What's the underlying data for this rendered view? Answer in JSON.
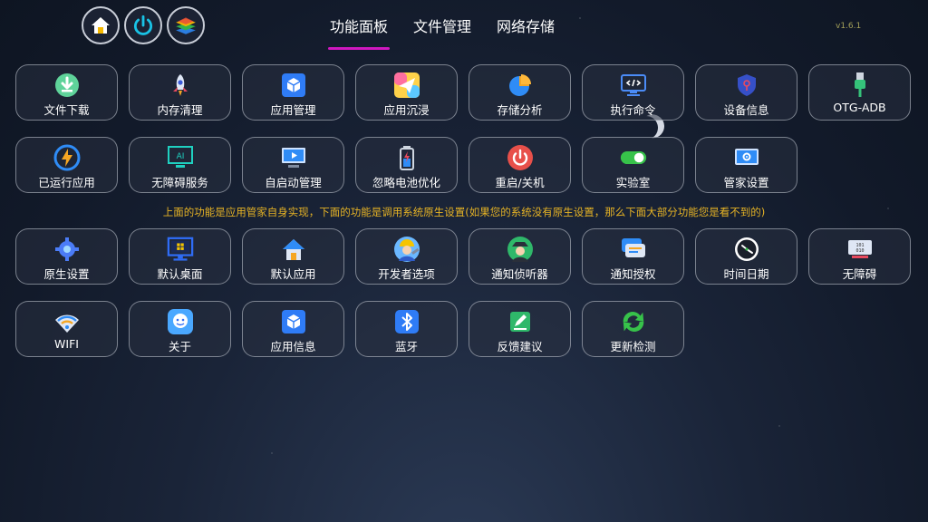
{
  "header": {
    "tabs": [
      "功能面板",
      "文件管理",
      "网络存储"
    ],
    "version": "v1.6.1"
  },
  "top_icons": [
    "home-icon",
    "power-icon",
    "layers-icon"
  ],
  "rows": {
    "r1": [
      "文件下载",
      "内存清理",
      "应用管理",
      "应用沉浸",
      "存储分析",
      "执行命令",
      "设备信息",
      "OTG-ADB"
    ],
    "r2": [
      "已运行应用",
      "无障碍服务",
      "自启动管理",
      "忽略电池优化",
      "重启/关机",
      "实验室",
      "管家设置"
    ],
    "r3": [
      "原生设置",
      "默认桌面",
      "默认应用",
      "开发者选项",
      "通知侦听器",
      "通知授权",
      "时间日期",
      "无障碍"
    ],
    "r4": [
      "WIFI",
      "关于",
      "应用信息",
      "蓝牙",
      "反馈建议",
      "更新检测"
    ]
  },
  "note": "上面的功能是应用管家自身实现，下面的功能是调用系统原生设置(如果您的系统没有原生设置，那么下面大部分功能您是看不到的)"
}
